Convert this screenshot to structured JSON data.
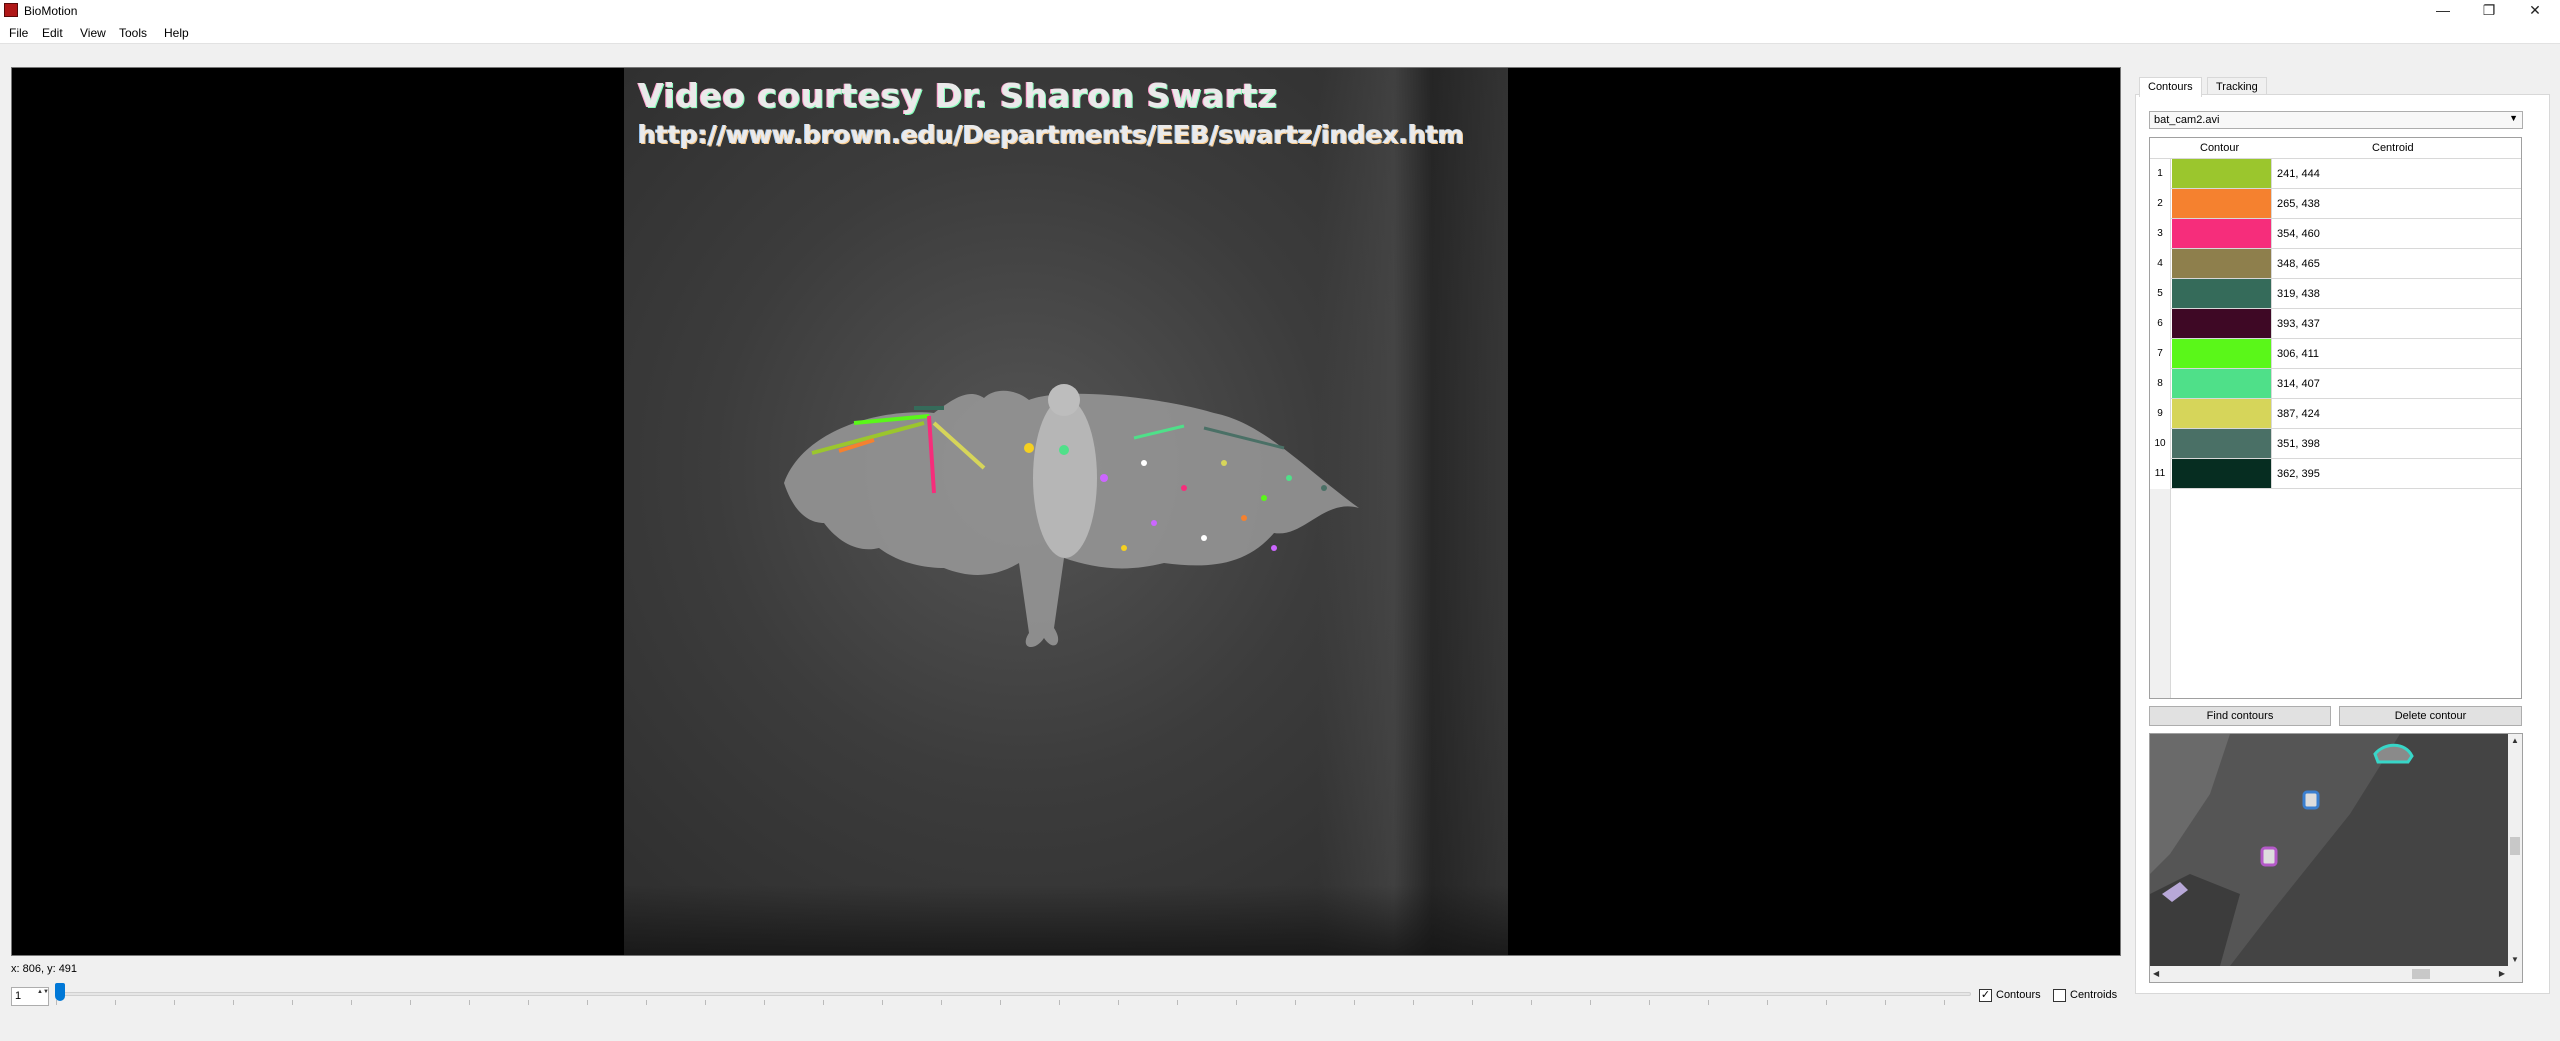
{
  "window": {
    "title": "BioMotion",
    "minimize": "—",
    "maximize": "❐",
    "close": "✕"
  },
  "menu": {
    "file": "File",
    "edit": "Edit",
    "view": "View",
    "tools": "Tools",
    "help": "Help"
  },
  "video": {
    "credit_line1": "Video courtesy Dr. Sharon Swartz",
    "credit_line2": "http://www.brown.edu/Departments/EEB/swartz/index.htm"
  },
  "status": {
    "coords": "x: 806, y: 491"
  },
  "playback": {
    "frame": "1",
    "spin_arrows": "▲▼",
    "position": 0
  },
  "overlays": {
    "contours_label": "Contours",
    "contours_checked": "✓",
    "centroids_label": "Centroids"
  },
  "panel": {
    "tabs": {
      "contours": "Contours",
      "tracking": "Tracking"
    },
    "video_file": "bat_cam2.avi",
    "video_file_arrow": "▼",
    "table": {
      "col_contour": "Contour",
      "col_centroid": "Centroid",
      "rows": [
        {
          "n": "1",
          "color": "#9bc62d",
          "centroid": "241, 444"
        },
        {
          "n": "2",
          "color": "#f5812f",
          "centroid": "265, 438"
        },
        {
          "n": "3",
          "color": "#f62d7b",
          "centroid": "354, 460"
        },
        {
          "n": "4",
          "color": "#8e7f4c",
          "centroid": "348, 465"
        },
        {
          "n": "5",
          "color": "#356b5a",
          "centroid": "319, 438"
        },
        {
          "n": "6",
          "color": "#3e0825",
          "centroid": "393, 437"
        },
        {
          "n": "7",
          "color": "#5af719",
          "centroid": "306, 411"
        },
        {
          "n": "8",
          "color": "#4fe089",
          "centroid": "314, 407"
        },
        {
          "n": "9",
          "color": "#d6d55a",
          "centroid": "387, 424"
        },
        {
          "n": "10",
          "color": "#4a7066",
          "centroid": "351, 398"
        },
        {
          "n": "11",
          "color": "#062d21",
          "centroid": "362, 395"
        }
      ]
    },
    "find_contours": "Find contours",
    "delete_contour": "Delete contour",
    "scroll": {
      "up": "▲",
      "down": "▼",
      "left": "◀",
      "right": "▶"
    }
  }
}
